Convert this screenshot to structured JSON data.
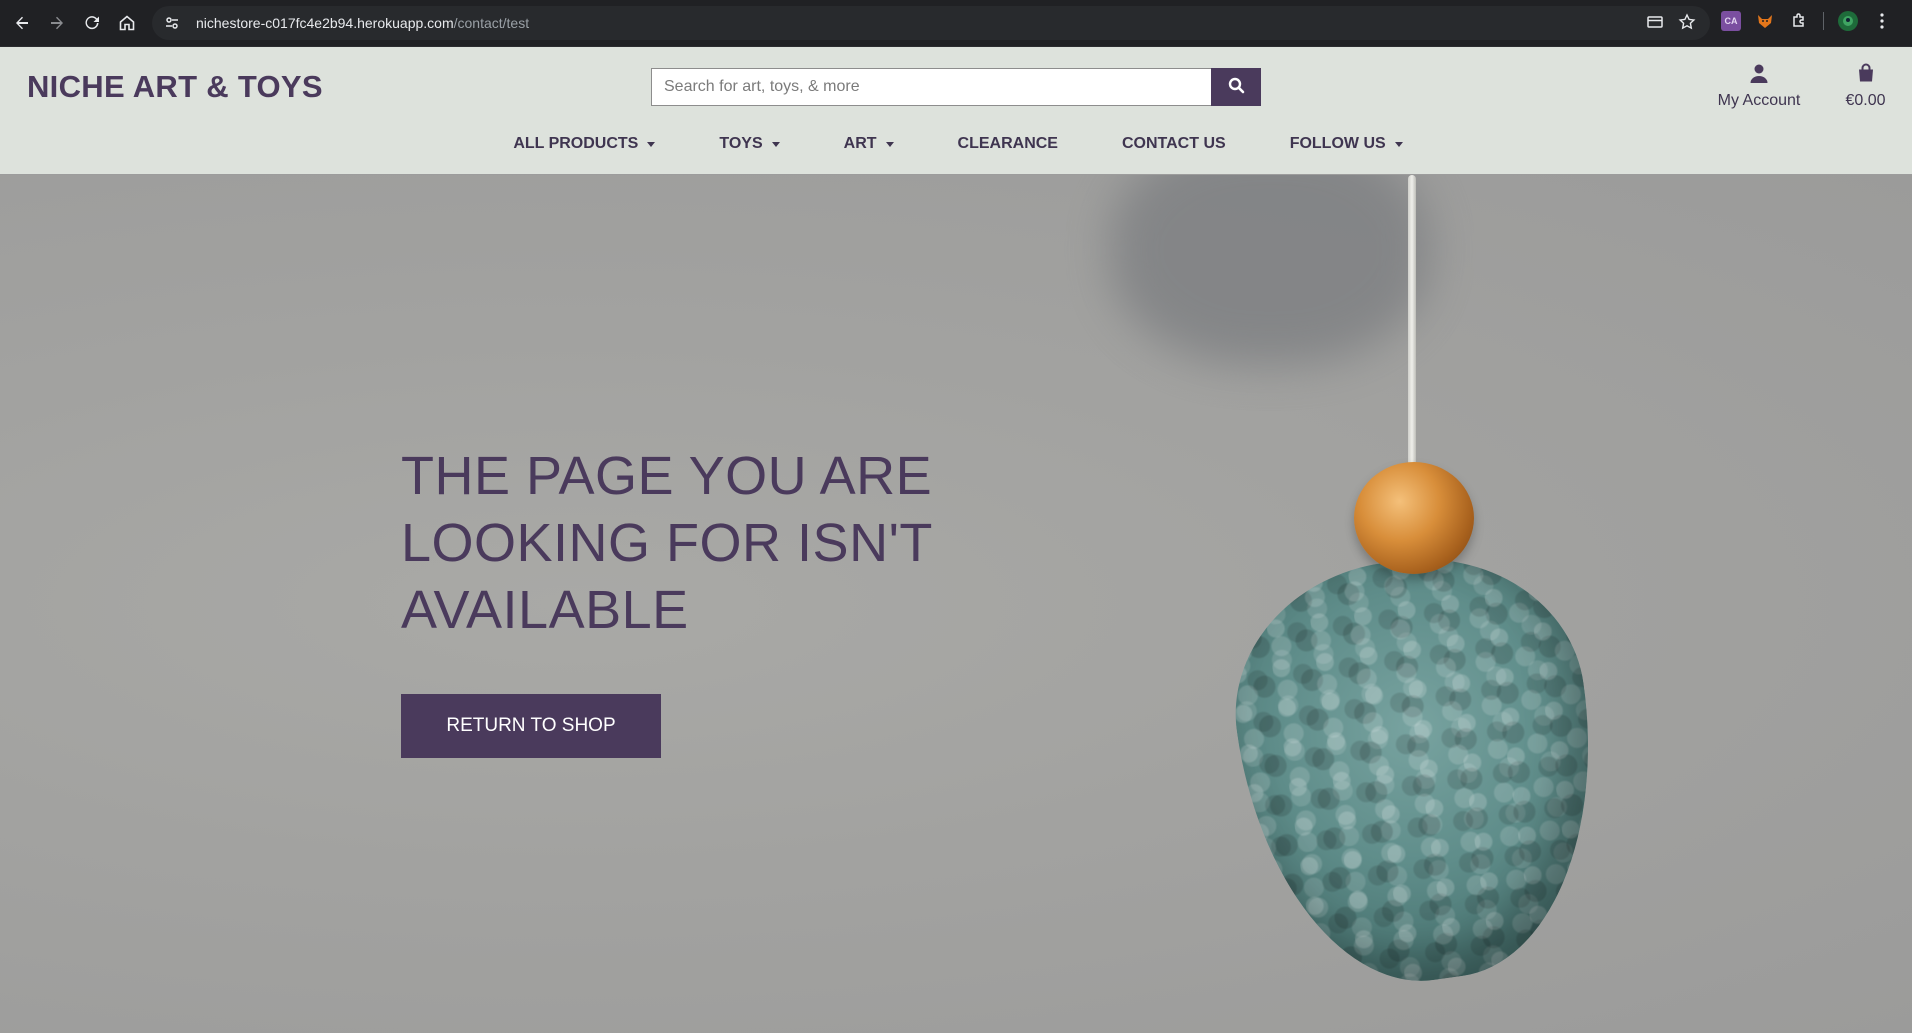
{
  "browser": {
    "url_host": "nichestore-c017fc4e2b94.herokuapp.com",
    "url_path": "/contact/test",
    "extension_label": "CA"
  },
  "header": {
    "brand": "NICHE ART & TOYS",
    "search_placeholder": "Search for art, toys, & more",
    "account_label": "My Account",
    "bag_total": "€0.00"
  },
  "nav": {
    "items": [
      {
        "label": "ALL PRODUCTS",
        "dropdown": true
      },
      {
        "label": "TOYS",
        "dropdown": true
      },
      {
        "label": "ART",
        "dropdown": true
      },
      {
        "label": "CLEARANCE",
        "dropdown": false
      },
      {
        "label": "CONTACT US",
        "dropdown": false
      },
      {
        "label": "FOLLOW US",
        "dropdown": true
      }
    ]
  },
  "hero": {
    "heading_line1": "THE PAGE YOU ARE",
    "heading_line2": "LOOKING FOR ISN'T",
    "heading_line3": "AVAILABLE",
    "button_label": "RETURN TO SHOP"
  },
  "colors": {
    "brand": "#4a3a5c",
    "header_bg": "#dde2dc",
    "chrome_bg": "#202124"
  },
  "icons": [
    "back-icon",
    "forward-icon",
    "reload-icon",
    "home-icon",
    "site-info-icon",
    "card-icon",
    "star-icon",
    "extension-ca-icon",
    "fox-icon",
    "puzzle-icon",
    "profile-icon",
    "menu-icon",
    "search-icon",
    "user-icon",
    "shopping-bag-icon"
  ]
}
